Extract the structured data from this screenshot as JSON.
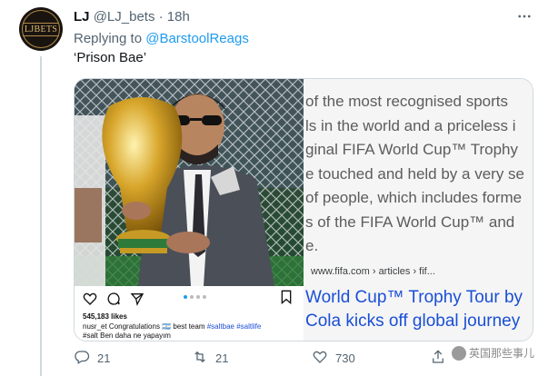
{
  "tweet": {
    "display_name": "LJ",
    "handle": "@LJ_bets",
    "separator": "·",
    "time": "18h",
    "more_icon": "more-horizontal-icon",
    "replying_prefix": "Replying to ",
    "replying_to": "@BarstoolReags",
    "text": "‘Prison Bae’"
  },
  "avatar": {
    "logo_text": "LJBETS"
  },
  "media": {
    "instagram": {
      "icons": [
        "heart-icon",
        "comment-icon",
        "share-icon",
        "bookmark-icon"
      ],
      "likes": "545,183 likes",
      "caption_user": "nusr_et",
      "caption_text": " Congratulations ",
      "caption_emoji": "🇦🇷",
      "caption_rest": " best team ",
      "caption_tags": "#saltbae #saltlife",
      "caption_line2": "#salt Ben daha ne yapayım"
    },
    "web_snippet": {
      "body_lines": [
        "of the most recognised sports",
        "ls in the world and a priceless i",
        "ginal FIFA World Cup™ Trophy",
        "e touched and held by a very se",
        "of people, which includes forme",
        "s of the FIFA World Cup™ and",
        "e."
      ],
      "url": "www.fifa.com › articles › fif...",
      "title_lines": [
        "World Cup™ Trophy Tour by",
        "Cola kicks off global journey"
      ]
    }
  },
  "actions": {
    "reply_count": "21",
    "retweet_count": "21",
    "like_count": "730",
    "icons": [
      "reply-icon",
      "retweet-icon",
      "like-icon",
      "share-icon"
    ]
  },
  "watermark": {
    "text": "英国那些事儿"
  },
  "colors": {
    "link_blue": "#1d9bf0",
    "secondary_text": "#536471",
    "web_title_blue": "#1a4fd6"
  }
}
